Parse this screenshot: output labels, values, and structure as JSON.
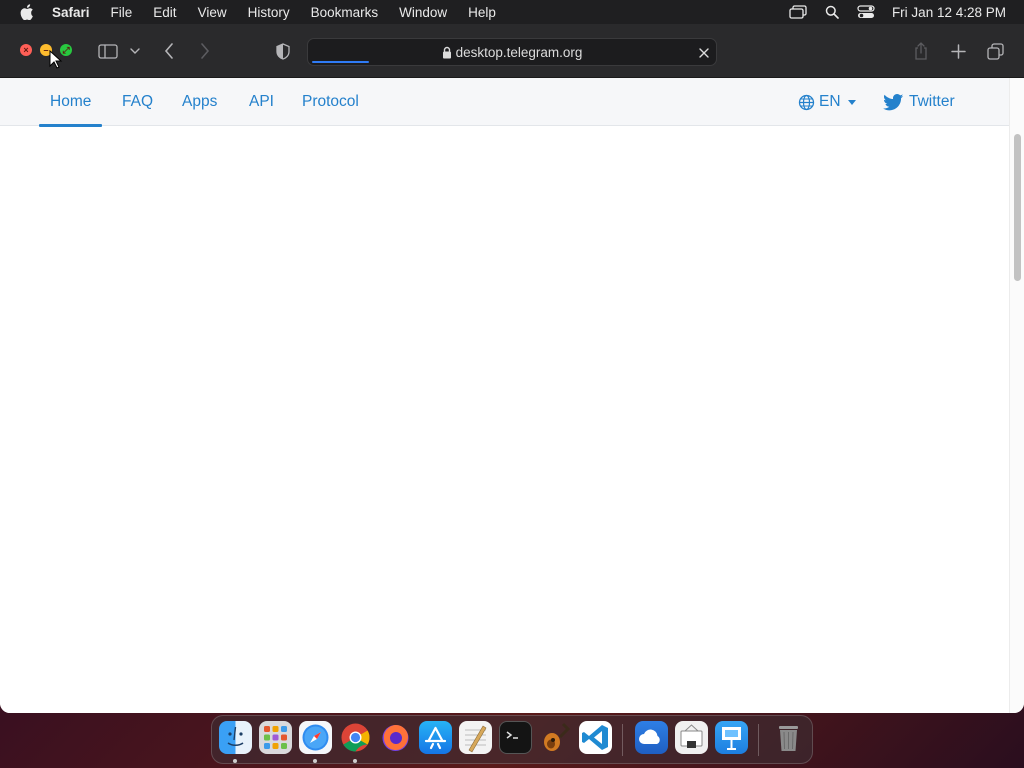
{
  "menubar": {
    "apple_icon": "apple-logo",
    "items": [
      "Safari",
      "File",
      "Edit",
      "View",
      "History",
      "Bookmarks",
      "Window",
      "Help"
    ],
    "status_icons": [
      "screen-mirroring-icon",
      "spotlight-search-icon",
      "control-center-icon"
    ],
    "clock": "Fri Jan 12  4:28 PM"
  },
  "toolbar": {
    "url": "desktop.telegram.org",
    "loading_progress": 0.14
  },
  "site_nav": {
    "links": [
      "Home",
      "FAQ",
      "Apps",
      "API",
      "Protocol"
    ],
    "active": "Home",
    "language": "EN",
    "twitter_label": "Twitter"
  },
  "dock": {
    "apps": [
      "Finder",
      "Launchpad",
      "Safari",
      "Chrome",
      "Firefox",
      "App Store",
      "TextEdit",
      "Terminal",
      "GarageBand",
      "Visual Studio Code",
      "Weather",
      "Preview",
      "Keynote",
      "Trash"
    ]
  },
  "colors": {
    "link": "#2481cc",
    "menubar_bg": "#1f1f21",
    "toolbar_bg": "#2a2a2c"
  }
}
